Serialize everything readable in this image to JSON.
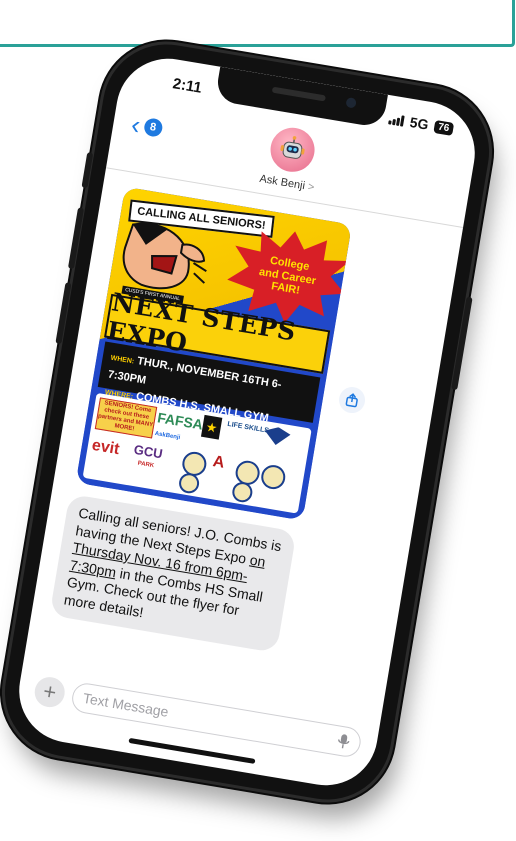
{
  "status_bar": {
    "time": "2:11",
    "network": "5G",
    "battery": "76"
  },
  "header": {
    "back_count": "8",
    "contact_name": "Ask Benji",
    "contact_chevron": ">"
  },
  "flyer": {
    "callout": "CALLING ALL SENIORS!",
    "burst": "College and Career FAIR!",
    "subtitle": "CUSD'S FIRST ANNUAL",
    "title": "NEXT STEPS EXPO",
    "when_label": "WHEN:",
    "when": "THUR., NOVEMBER 16TH 6-7:30PM",
    "where_label": "WHERE:",
    "where": "COMBS H.S. SMALL GYM",
    "seniors_note": "SENIORS! Come check out these partners and MANY MORE!",
    "logos": {
      "fafsa": "FAFSA",
      "army": "★",
      "life_skills": "LIFE SKILLS",
      "ask_benji": "AskBenji",
      "evit": "evit",
      "gcu": "GCU",
      "park": "PARK",
      "arizona": "A"
    }
  },
  "message": {
    "part1": "Calling all seniors! J.O. Combs is having the Next Steps Expo ",
    "link": "on Thursday Nov. 16 from 6pm-7:30pm",
    "part2": " in the Combs HS Small Gym. Check out the flyer for more details!"
  },
  "composer": {
    "placeholder": "Text Message",
    "plus": "+"
  },
  "colors": {
    "imessage_blue": "#1f7ae0",
    "bubble_gray": "#e9e9eb",
    "frame_teal": "#2aa198"
  }
}
